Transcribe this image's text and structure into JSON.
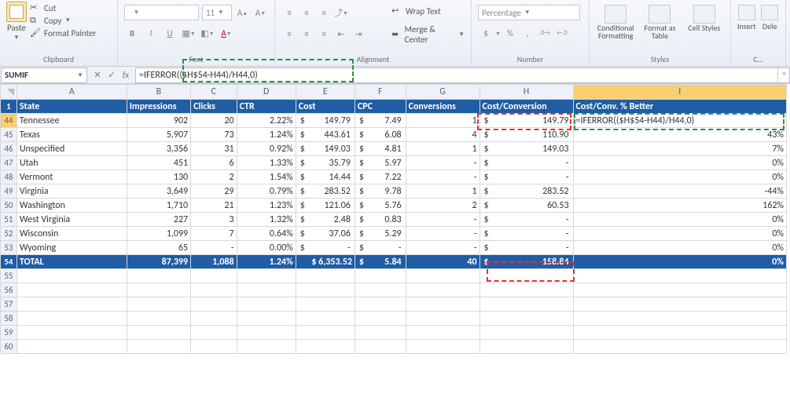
{
  "ribbon": {
    "clipboard": {
      "label": "Clipboard",
      "paste": "Paste",
      "cut": "Cut",
      "copy": "Copy",
      "painter": "Format Painter"
    },
    "font": {
      "label": "Font",
      "font_size": "11",
      "b": "B",
      "i": "I",
      "u": "U"
    },
    "alignment": {
      "label": "Alignment",
      "wrap": "Wrap Text",
      "merge": "Merge & Center"
    },
    "number": {
      "label": "Number",
      "format": "Percentage",
      "dollar": "$",
      "percent": "%",
      "comma": ",",
      "inc": ".0 .00",
      "dec": ".00 .0"
    },
    "styles": {
      "label": "Styles",
      "cond": "Conditional Formatting",
      "table": "Format as Table",
      "cell": "Cell Styles"
    },
    "cells": {
      "label": "C…",
      "insert": "Insert",
      "delete": "Dele"
    }
  },
  "namebox": "SUMIF",
  "formula_text": "=IFERROR(($H$54-H44)/H44,0)",
  "columns": [
    "A",
    "B",
    "C",
    "D",
    "E",
    "F",
    "G",
    "H",
    "I"
  ],
  "header": {
    "A": "State",
    "B": "Impressions",
    "C": "Clicks",
    "D": "CTR",
    "E": "Cost",
    "F": "CPC",
    "G": "Conversions",
    "H": "Cost/Conversion",
    "I": "Cost/Conv. % Better"
  },
  "rows": [
    {
      "n": 44,
      "A": "Tennessee",
      "B": "902",
      "C": "20",
      "D": "2.22%",
      "E": "149.79",
      "F": "7.49",
      "G": "1",
      "H": "149.79",
      "I": "=IFERROR(($H$54-H44)/H44,0)",
      "is_formula_row": true
    },
    {
      "n": 45,
      "A": "Texas",
      "B": "5,907",
      "C": "73",
      "D": "1.24%",
      "E": "443.61",
      "F": "6.08",
      "G": "4",
      "H": "110.90",
      "I": "43%"
    },
    {
      "n": 46,
      "A": "Unspecified",
      "B": "3,356",
      "C": "31",
      "D": "0.92%",
      "E": "149.03",
      "F": "4.81",
      "G": "1",
      "H": "149.03",
      "I": "7%"
    },
    {
      "n": 47,
      "A": "Utah",
      "B": "451",
      "C": "6",
      "D": "1.33%",
      "E": "35.79",
      "F": "5.97",
      "G": "-",
      "H": "-",
      "I": "0%"
    },
    {
      "n": 48,
      "A": "Vermont",
      "B": "130",
      "C": "2",
      "D": "1.54%",
      "E": "14.44",
      "F": "7.22",
      "G": "-",
      "H": "-",
      "I": "0%"
    },
    {
      "n": 49,
      "A": "Virginia",
      "B": "3,649",
      "C": "29",
      "D": "0.79%",
      "E": "283.52",
      "F": "9.78",
      "G": "1",
      "H": "283.52",
      "I": "-44%"
    },
    {
      "n": 50,
      "A": "Washington",
      "B": "1,710",
      "C": "21",
      "D": "1.23%",
      "E": "121.06",
      "F": "5.76",
      "G": "2",
      "H": "60.53",
      "I": "162%"
    },
    {
      "n": 51,
      "A": "West Virginia",
      "B": "227",
      "C": "3",
      "D": "1.32%",
      "E": "2.48",
      "F": "0.83",
      "G": "-",
      "H": "-",
      "I": "0%"
    },
    {
      "n": 52,
      "A": "Wisconsin",
      "B": "1,099",
      "C": "7",
      "D": "0.64%",
      "E": "37.06",
      "F": "5.29",
      "G": "-",
      "H": "-",
      "I": "0%"
    },
    {
      "n": 53,
      "A": "Wyoming",
      "B": "65",
      "C": "-",
      "D": "0.00%",
      "E": "-",
      "F": "-",
      "G": "-",
      "H": "-",
      "I": "0%"
    }
  ],
  "total": {
    "n": 54,
    "A": "TOTAL",
    "B": "87,399",
    "C": "1,088",
    "D": "1.24%",
    "E": "$ 6,353.52",
    "F": "5.84",
    "G": "40",
    "H": "158.84",
    "I": "0%"
  },
  "empty_rows": [
    55,
    56,
    57,
    58,
    59,
    60
  ]
}
